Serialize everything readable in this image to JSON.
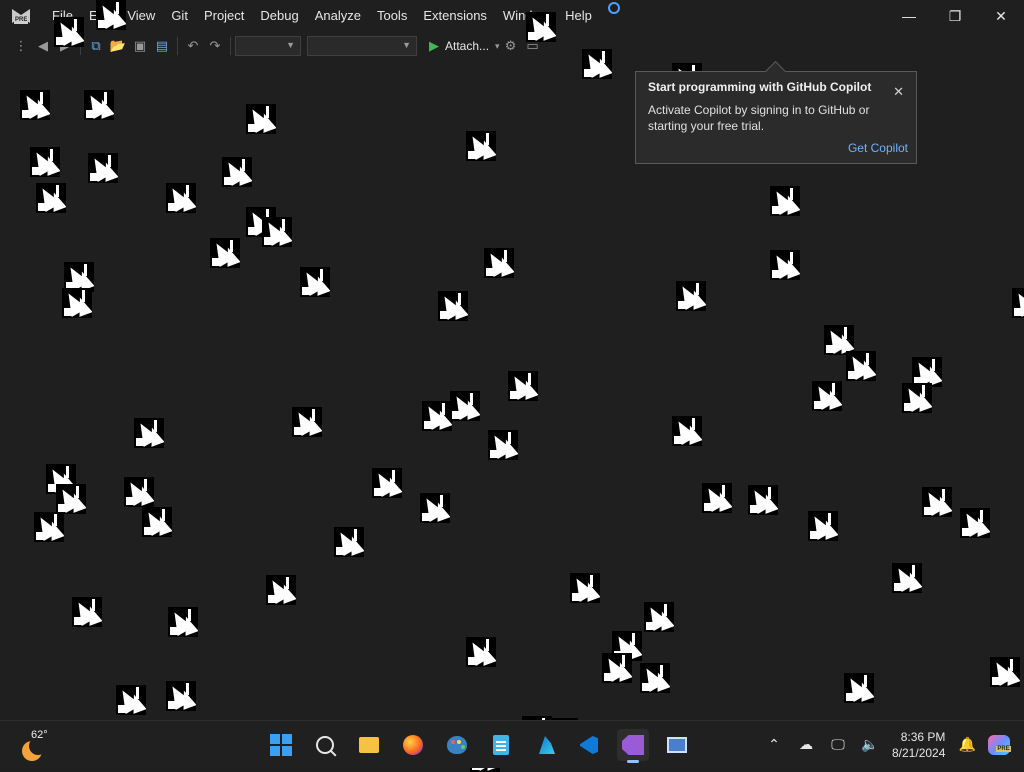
{
  "window": {
    "menu": [
      "File",
      "Edit",
      "View",
      "Git",
      "Project",
      "Debug",
      "Analyze",
      "Tools",
      "Extensions",
      "Window",
      "Help"
    ],
    "logo_badge": "PRE",
    "controls": {
      "minimize": "—",
      "restore": "❐",
      "close": "✕"
    }
  },
  "toolbar": {
    "attach_label": "Attach...",
    "attach_arrow": "▾"
  },
  "copilot_popup": {
    "title": "Start programming with GitHub Copilot",
    "body": "Activate Copilot by signing in to GitHub or starting your free trial.",
    "link": "Get Copilot",
    "close": "✕"
  },
  "taskbar": {
    "weather": {
      "temp": "62°"
    },
    "clock": {
      "time": "8:36 PM",
      "date": "8/21/2024"
    },
    "apps": [
      "start",
      "search",
      "file-explorer",
      "firefox",
      "paint",
      "notepad",
      "azure-data-studio",
      "vs-code",
      "visual-studio-preview",
      "remote-desktop"
    ],
    "copilot_badge": "PRE"
  },
  "colors": {
    "background": "#1f1f1f",
    "accent_link": "#6eb3ff",
    "play_green": "#3fb950"
  }
}
